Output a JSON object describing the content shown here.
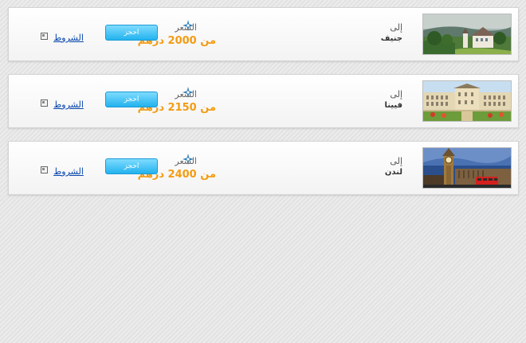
{
  "deals": [
    {
      "to_label": "إلى",
      "destination": "جنيف",
      "image": "geneva-chateau-photo",
      "price_label": "السعر",
      "price": "من 2000 درهم",
      "book_label": "احجز",
      "terms_label": "الشروط",
      "plane_icon": "plane-icon"
    },
    {
      "to_label": "إلى",
      "destination": "فيينا",
      "image": "vienna-palace-photo",
      "price_label": "السعر",
      "price": "من 2150 درهم",
      "book_label": "احجز",
      "terms_label": "الشروط",
      "plane_icon": "plane-icon"
    },
    {
      "to_label": "إلى",
      "destination": "لندن",
      "image": "london-big-ben-photo",
      "price_label": "السعر",
      "price": "من 2400 درهم",
      "book_label": "احجز",
      "terms_label": "الشروط",
      "plane_icon": "plane-icon"
    }
  ],
  "colors": {
    "price": "#f39c12",
    "button_top": "#7fdcff",
    "button_bottom": "#22b2ee",
    "link": "#0645ad"
  }
}
